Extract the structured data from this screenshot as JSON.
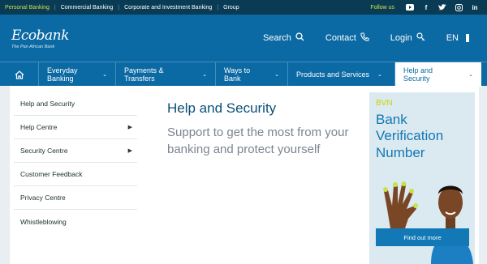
{
  "topbar": {
    "links": [
      "Personal Banking",
      "Commercial Banking",
      "Corporate and Investment Banking",
      "Group"
    ],
    "follow_label": "Follow us",
    "social_icons": [
      "youtube-icon",
      "facebook-icon",
      "twitter-icon",
      "instagram-icon",
      "linkedin-icon"
    ]
  },
  "header": {
    "logo_name": "Ecobank",
    "logo_tag": "The Pan African Bank",
    "search_label": "Search",
    "contact_label": "Contact",
    "login_label": "Login",
    "lang_label": "EN"
  },
  "mainnav": {
    "items": [
      "Everyday Banking",
      "Payments & Transfers",
      "Ways to Bank",
      "Products and Services",
      "Help and Security"
    ]
  },
  "sidebar": {
    "items": [
      "Help and Security",
      "Help Centre",
      "Security Centre",
      "Customer Feedback",
      "Privacy Centre",
      "Whistleblowing"
    ]
  },
  "hero": {
    "title": "Help and Security",
    "subtitle": "Support to get the most from your banking and protect yourself"
  },
  "ad": {
    "kicker": "BVN",
    "title_line1": "Bank",
    "title_line2": "Verification",
    "title_line3": "Number",
    "button_label": "Find out more"
  },
  "colors": {
    "brand_blue": "#0b69a3",
    "topbar_navy": "#0a3b55",
    "accent_lime": "#c9e04a"
  }
}
